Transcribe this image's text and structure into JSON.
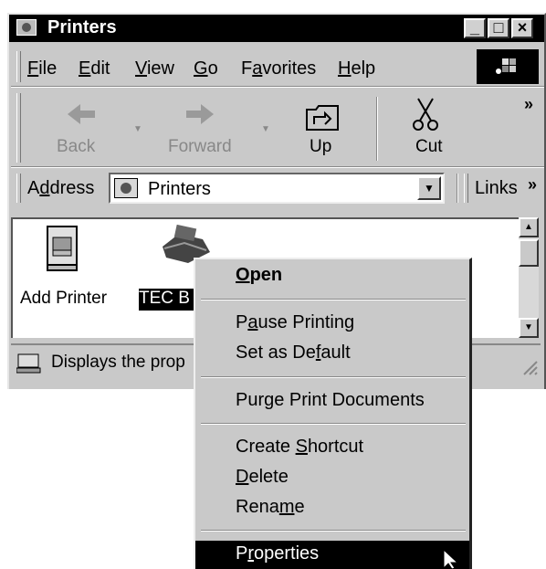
{
  "window": {
    "title": "Printers"
  },
  "menubar": {
    "items": [
      {
        "key": "F",
        "rest": "ile"
      },
      {
        "key": "E",
        "rest": "dit"
      },
      {
        "key": "V",
        "rest": "iew"
      },
      {
        "key": "G",
        "rest": "o"
      },
      {
        "pre": "F",
        "key": "a",
        "rest": "vorites"
      },
      {
        "key": "H",
        "rest": "elp"
      }
    ]
  },
  "toolbar": {
    "back": "Back",
    "forward": "Forward",
    "up": "Up",
    "cut": "Cut",
    "more": "»"
  },
  "address": {
    "pre": "A",
    "key": "d",
    "rest": "dress",
    "value": "Printers"
  },
  "links": {
    "label": "Links",
    "more": "»"
  },
  "icons": [
    {
      "label": "Add Printer"
    },
    {
      "label": "TEC B"
    }
  ],
  "status": {
    "text": "Displays the prop"
  },
  "context_menu": {
    "open": {
      "key": "O",
      "rest": "pen"
    },
    "pause": {
      "pre": "P",
      "key": "a",
      "rest": "use Printing"
    },
    "default": {
      "pre": "Set as De",
      "key": "f",
      "rest": "ault"
    },
    "purge": {
      "label": "Purge Print Documents"
    },
    "shortcut": {
      "pre": "Create ",
      "key": "S",
      "rest": "hortcut"
    },
    "delete": {
      "key": "D",
      "rest": "elete"
    },
    "rename": {
      "pre": "Rena",
      "key": "m",
      "rest": "e"
    },
    "properties": {
      "pre": "P",
      "key": "r",
      "rest": "operties"
    }
  }
}
